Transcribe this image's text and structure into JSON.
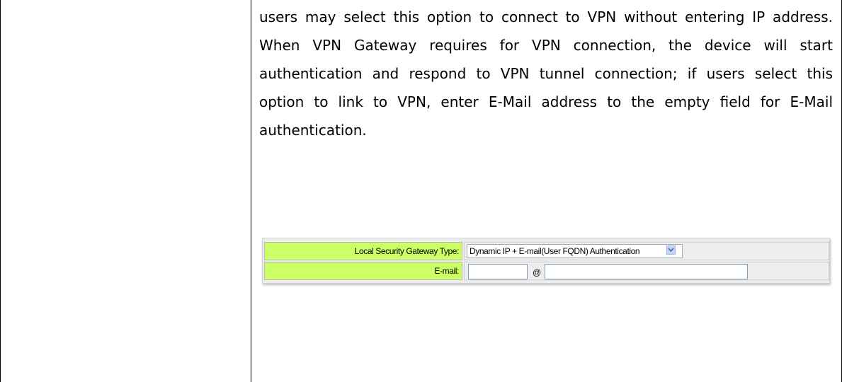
{
  "document": {
    "paragraph": "users may select this option to connect to VPN without entering IP address. When VPN Gateway requires for VPN connection, the device will start authentication and respond to VPN tunnel connection; if users select this option to link to VPN, enter E-Mail address to the empty field for E-Mail authentication."
  },
  "form": {
    "gateway_type_label": "Local Security Gateway Type:",
    "gateway_type_value": "Dynamic IP + E-mail(User FQDN) Authentication",
    "email_label": "E-mail:",
    "email_user_value": "",
    "email_at": "@",
    "email_domain_value": ""
  },
  "colors": {
    "label_background": "#ccff66",
    "field_background": "#eeeeee",
    "text": "#000000"
  }
}
